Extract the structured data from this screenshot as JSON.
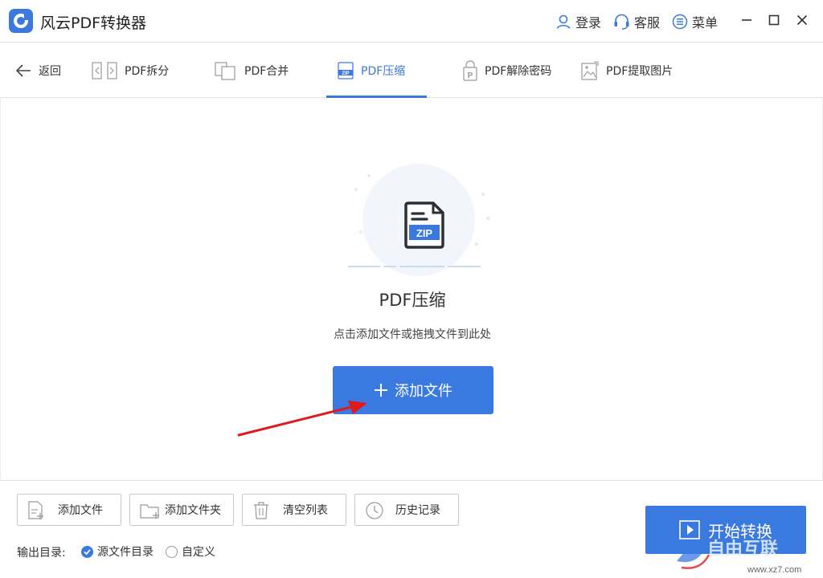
{
  "app": {
    "title": "风云PDF转换器"
  },
  "titlebar": {
    "login": "登录",
    "service": "客服",
    "menu": "菜单"
  },
  "tabs": {
    "back": "返回",
    "items": [
      {
        "label": "PDF拆分"
      },
      {
        "label": "PDF合并"
      },
      {
        "label": "PDF压缩",
        "active": true
      },
      {
        "label": "PDF解除密码"
      },
      {
        "label": "PDF提取图片"
      }
    ]
  },
  "main": {
    "icon_text": "ZIP",
    "title": "PDF压缩",
    "hint": "点击添加文件或拖拽文件到此处",
    "add_button": "添加文件"
  },
  "bottom": {
    "buttons": [
      "添加文件",
      "添加文件夹",
      "清空列表",
      "历史记录"
    ],
    "output_label": "输出目录:",
    "output_options": [
      {
        "label": "源文件目录",
        "checked": true
      },
      {
        "label": "自定义",
        "checked": false
      }
    ],
    "start_button": "开始转换"
  },
  "watermark": {
    "text": "自由互联",
    "url": "www.xz7.com"
  },
  "colors": {
    "accent": "#3a7ae0",
    "arrow": "#e0191c"
  }
}
